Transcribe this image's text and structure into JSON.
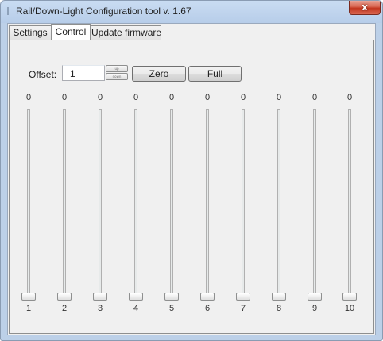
{
  "window": {
    "title": "Rail/Down-Light Configuration tool v. 1.67",
    "close_glyph": "x"
  },
  "tabs": [
    {
      "label": "Settings"
    },
    {
      "label": "Control",
      "active": true
    },
    {
      "label": "Update firmware"
    }
  ],
  "control": {
    "offset_label": "Offset:",
    "offset_value": "1",
    "spin_up_label": "up",
    "spin_down_label": "down",
    "zero_button": "Zero",
    "full_button": "Full",
    "channels": [
      {
        "label": "1",
        "value": "0",
        "level": 0
      },
      {
        "label": "2",
        "value": "0",
        "level": 0
      },
      {
        "label": "3",
        "value": "0",
        "level": 0
      },
      {
        "label": "4",
        "value": "0",
        "level": 0
      },
      {
        "label": "5",
        "value": "0",
        "level": 0
      },
      {
        "label": "6",
        "value": "0",
        "level": 0
      },
      {
        "label": "7",
        "value": "0",
        "level": 0
      },
      {
        "label": "8",
        "value": "0",
        "level": 0
      },
      {
        "label": "9",
        "value": "0",
        "level": 0
      },
      {
        "label": "10",
        "value": "0",
        "level": 0
      }
    ]
  }
}
